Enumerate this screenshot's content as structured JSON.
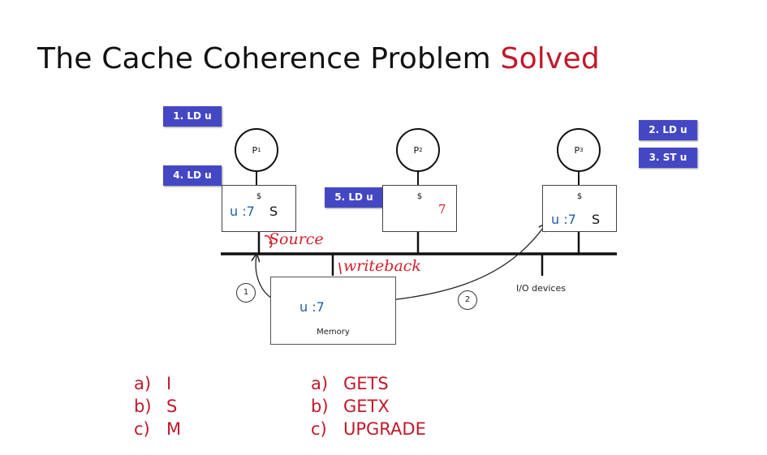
{
  "slide": {
    "title_main": "The Cache Coherence Problem",
    "title_accent": "Solved"
  },
  "tags": {
    "t1": "1. LD u",
    "t2": "2. LD u",
    "t3": "3. ST u",
    "t4": "4. LD u",
    "t5": "5. LD u"
  },
  "processors": {
    "p1": {
      "label": "P",
      "sub": "1"
    },
    "p2": {
      "label": "P",
      "sub": "2"
    },
    "p3": {
      "label": "P",
      "sub": "3"
    }
  },
  "caches": {
    "c1": {
      "dollar": "$",
      "value": "u :7",
      "state": "S"
    },
    "c2": {
      "dollar": "$",
      "value": "7"
    },
    "c3": {
      "dollar": "$",
      "value": "u :7",
      "state": "S"
    }
  },
  "annotations": {
    "source": "Source",
    "writeback": "writeback"
  },
  "memory": {
    "value": "u :7",
    "label": "Memory"
  },
  "io": "I/O devices",
  "steps": {
    "s1": "1",
    "s2": "2"
  },
  "states_list": [
    {
      "letter": "a)",
      "text": "I"
    },
    {
      "letter": "b)",
      "text": "S"
    },
    {
      "letter": "c)",
      "text": "M"
    }
  ],
  "requests_list": [
    {
      "letter": "a)",
      "text": "GETS"
    },
    {
      "letter": "b)",
      "text": "GETX"
    },
    {
      "letter": "c)",
      "text": "UPGRADE"
    }
  ],
  "colors": {
    "accent": "#c2182a",
    "tag_bg": "#4347c4",
    "value_blue": "#1f5fa8",
    "ink_red": "#d0202a"
  }
}
